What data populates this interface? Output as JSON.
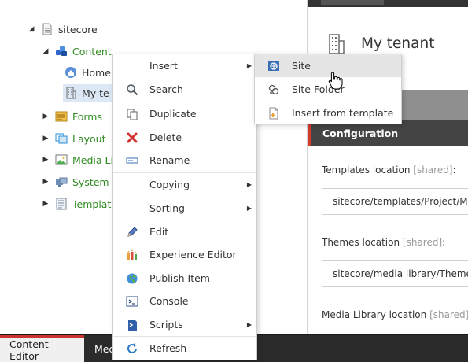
{
  "tree": {
    "items": [
      {
        "label": "sitecore",
        "toggle": "◢",
        "icon": "sitecore-icon"
      },
      {
        "label": "Content",
        "toggle": "◢",
        "icon": "content-icon"
      },
      {
        "label": "Home",
        "toggle": "",
        "icon": "home-icon"
      },
      {
        "label": "My te",
        "toggle": "",
        "icon": "tenant-icon"
      },
      {
        "label": "Forms",
        "toggle": "▶",
        "icon": "forms-icon"
      },
      {
        "label": "Layout",
        "toggle": "▶",
        "icon": "layout-icon"
      },
      {
        "label": "Media Li",
        "toggle": "▶",
        "icon": "media-library-icon"
      },
      {
        "label": "System",
        "toggle": "▶",
        "icon": "system-icon"
      },
      {
        "label": "Template",
        "toggle": "▶",
        "icon": "templates-icon"
      }
    ]
  },
  "context_menu": {
    "items": [
      {
        "label": "Insert",
        "icon": "",
        "has_submenu": true
      },
      {
        "label": "Search",
        "icon": "search-icon",
        "has_submenu": false
      },
      {
        "label": "Duplicate",
        "icon": "duplicate-icon",
        "has_submenu": false
      },
      {
        "label": "Delete",
        "icon": "delete-icon",
        "has_submenu": false
      },
      {
        "label": "Rename",
        "icon": "rename-icon",
        "has_submenu": false
      },
      {
        "label": "Copying",
        "icon": "",
        "has_submenu": true
      },
      {
        "label": "Sorting",
        "icon": "",
        "has_submenu": true
      },
      {
        "label": "Edit",
        "icon": "edit-icon",
        "has_submenu": false
      },
      {
        "label": "Experience Editor",
        "icon": "experience-editor-icon",
        "has_submenu": false
      },
      {
        "label": "Publish Item",
        "icon": "publish-icon",
        "has_submenu": false
      },
      {
        "label": "Console",
        "icon": "console-icon",
        "has_submenu": false
      },
      {
        "label": "Scripts",
        "icon": "scripts-icon",
        "has_submenu": true
      },
      {
        "label": "Refresh",
        "icon": "refresh-icon",
        "has_submenu": false
      }
    ],
    "submenu_arrow": "▶"
  },
  "submenu": {
    "items": [
      {
        "label": "Site",
        "icon": "site-icon"
      },
      {
        "label": "Site Folder",
        "icon": "site-folder-icon"
      },
      {
        "label": "Insert from template",
        "icon": "insert-template-icon"
      }
    ]
  },
  "right_pane": {
    "title": "My tenant",
    "section": "Configuration",
    "fields": [
      {
        "label": "Templates location",
        "shared": "[shared]",
        "colon": ":",
        "value": "sitecore/templates/Project/M"
      },
      {
        "label": "Themes location",
        "shared": "[shared]",
        "colon": ":",
        "value": "sitecore/media library/Theme"
      },
      {
        "label": "Media Library location",
        "shared": "[shared]",
        "colon": "",
        "value": ""
      }
    ]
  },
  "bottom_bar": {
    "tabs": [
      {
        "label": "Content Editor"
      },
      {
        "label": "Med"
      }
    ]
  },
  "colors": {
    "accent_red": "#d33a2c",
    "tree_green": "#2e8b1f",
    "selection": "#dce8f5",
    "config_bar": "#444444"
  }
}
